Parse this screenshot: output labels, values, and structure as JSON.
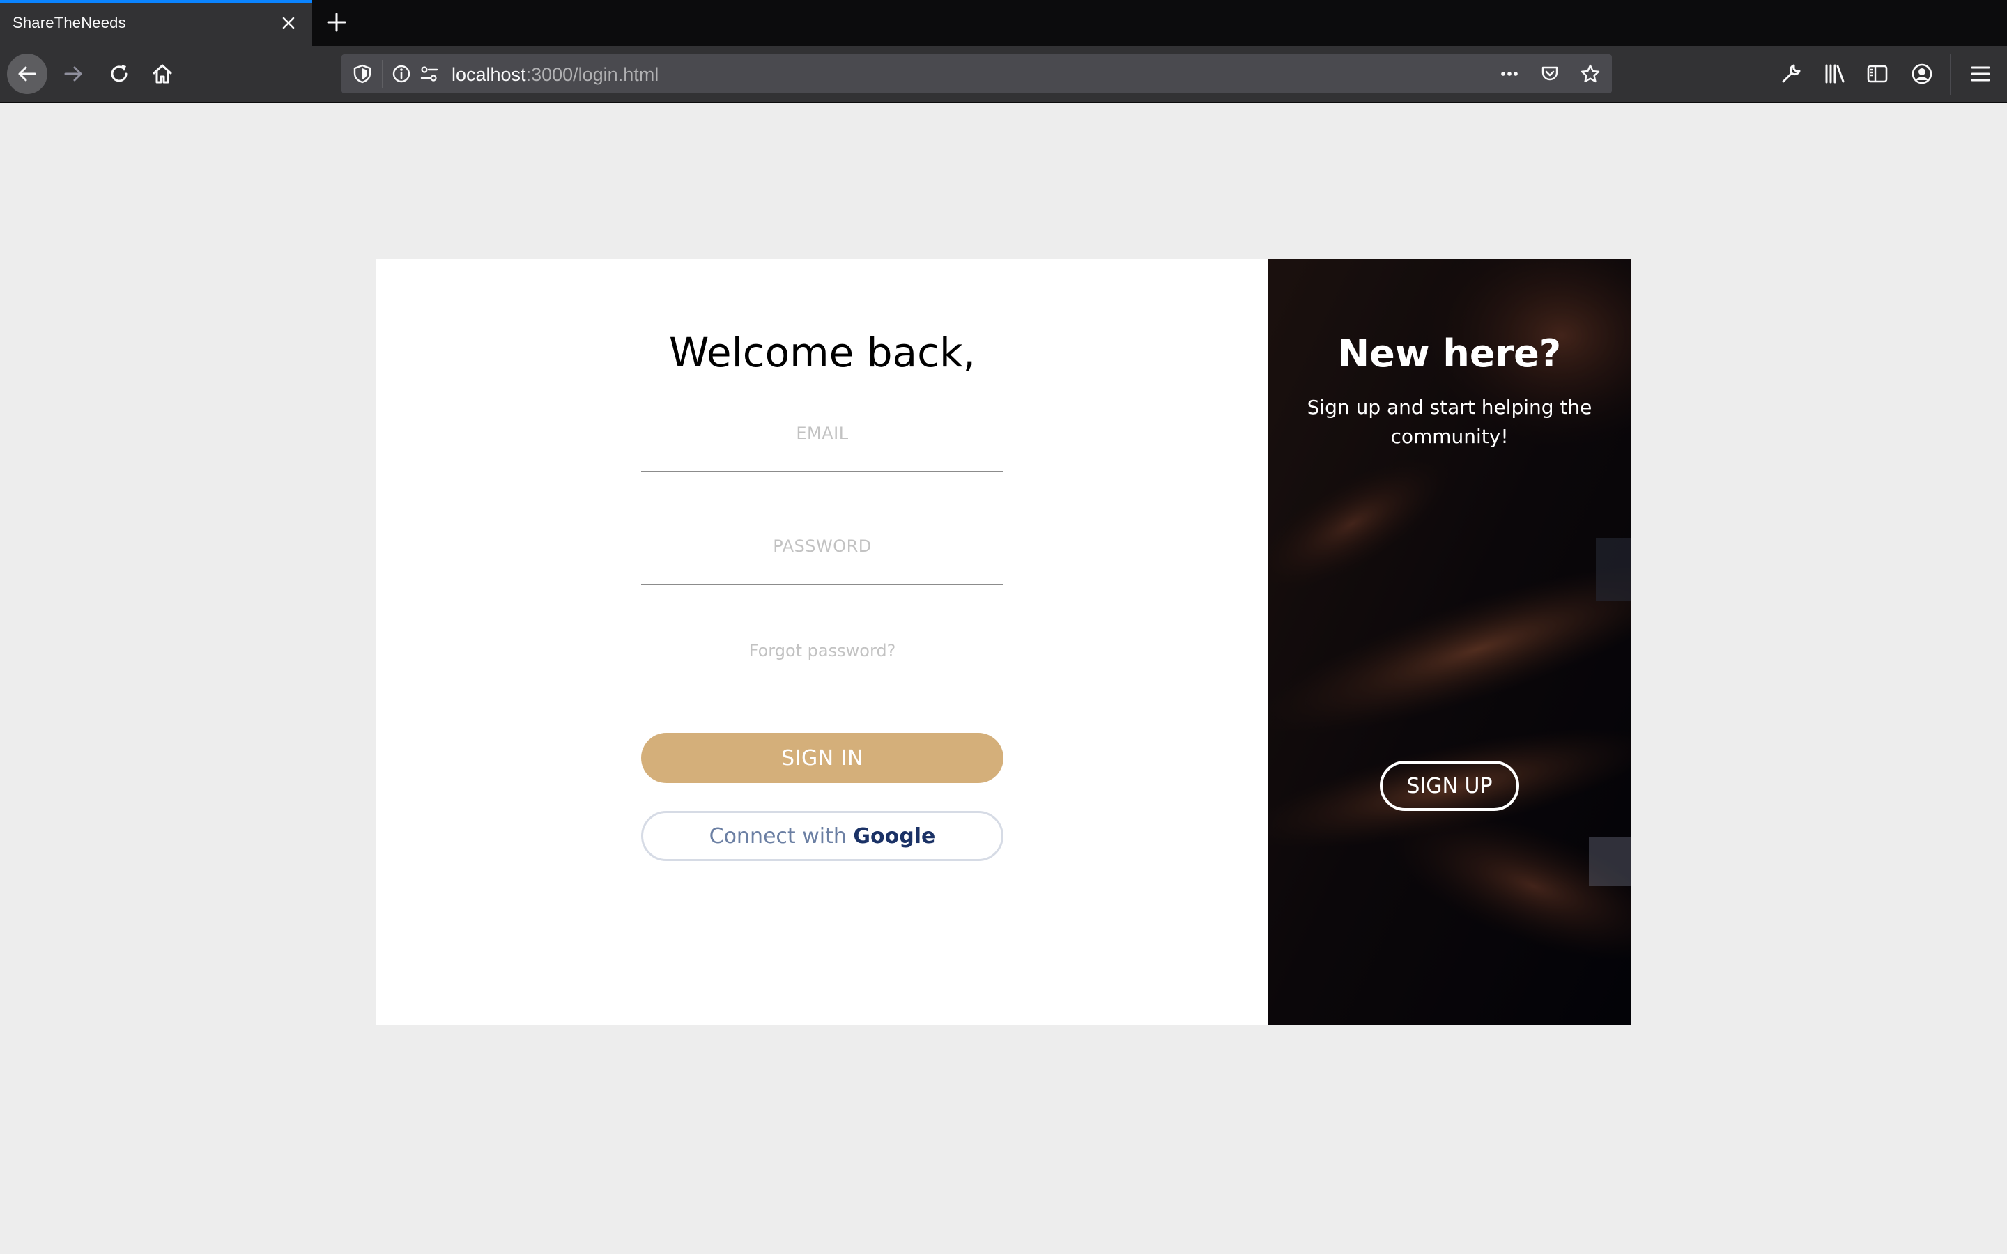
{
  "browser": {
    "tab_title": "ShareTheNeeds",
    "url_host": "localhost",
    "url_rest": ":3000/login.html",
    "accent_color": "#0a84ff",
    "icons": [
      "close-icon",
      "plus-icon",
      "back-arrow-icon",
      "forward-arrow-icon",
      "reload-icon",
      "home-icon",
      "shield-icon",
      "info-icon",
      "permissions-icon",
      "more-icon",
      "pocket-icon",
      "star-icon",
      "wrench-icon",
      "library-icon",
      "sidebar-icon",
      "account-icon",
      "hamburger-menu-icon"
    ]
  },
  "login": {
    "heading": "Welcome back,",
    "email_label": "EMAIL",
    "password_label": "PASSWORD",
    "forgot_link": "Forgot password?",
    "signin_label": "SIGN IN",
    "google_prefix": "Connect with",
    "google_brand": "Google",
    "signin_color": "#d4af7a"
  },
  "promo": {
    "title": "New here?",
    "subtitle": "Sign up and start helping the community!",
    "signup_label": "SIGN UP"
  }
}
